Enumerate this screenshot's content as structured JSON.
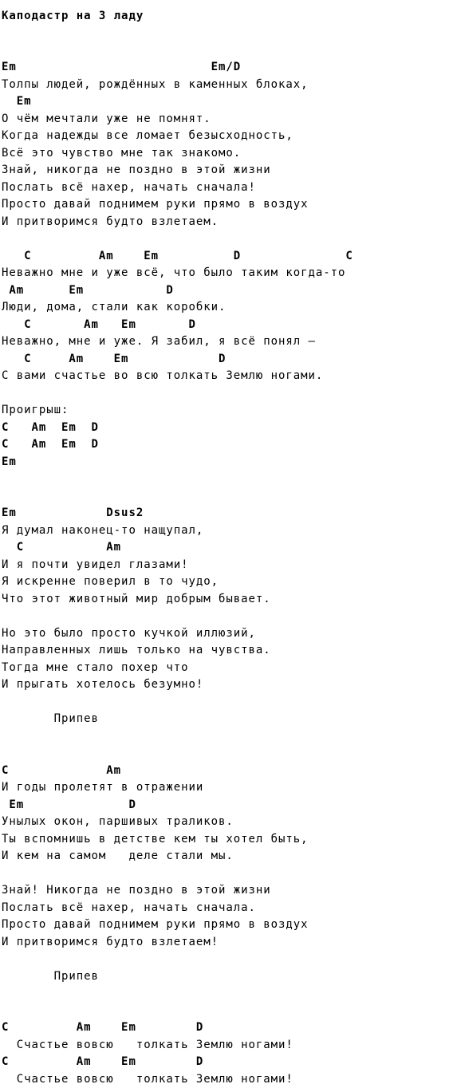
{
  "document": {
    "kind": "guitar-chord-sheet",
    "title": "Каподастр на 3 ладу",
    "language": "ru"
  },
  "lines": [
    {
      "type": "blank",
      "text": ""
    },
    {
      "type": "chord",
      "text": "Em                          Em/D"
    },
    {
      "type": "lyric",
      "text": "Толпы людей, рождённых в каменных блоках,"
    },
    {
      "type": "chord",
      "text": "  Em"
    },
    {
      "type": "lyric",
      "text": "О чём мечтали уже не помнят."
    },
    {
      "type": "lyric",
      "text": "Когда надежды все ломает безысходность,"
    },
    {
      "type": "lyric",
      "text": "Всё это чувство мне так знакомо."
    },
    {
      "type": "lyric",
      "text": "Знай, никогда не поздно в этой жизни"
    },
    {
      "type": "lyric",
      "text": "Послать всё нахер, начать сначала!"
    },
    {
      "type": "lyric",
      "text": "Просто давай поднимем руки прямо в воздух"
    },
    {
      "type": "lyric",
      "text": "И притворимся будто взлетаем."
    },
    {
      "type": "blank",
      "text": ""
    },
    {
      "type": "chord",
      "text": "   C         Am    Em          D              C"
    },
    {
      "type": "lyric",
      "text": "Неважно мне и уже всё, что было таким когда-то"
    },
    {
      "type": "chord",
      "text": " Am      Em           D"
    },
    {
      "type": "lyric",
      "text": "Люди, дома, стали как коробки."
    },
    {
      "type": "chord",
      "text": "   C       Am   Em       D"
    },
    {
      "type": "lyric",
      "text": "Неважно, мне и уже. Я забил, я всё понял –"
    },
    {
      "type": "chord",
      "text": "   C     Am    Em            D"
    },
    {
      "type": "lyric",
      "text": "С вами счастье во всю толкать Землю ногами."
    },
    {
      "type": "blank",
      "text": ""
    },
    {
      "type": "label",
      "text": "Проигрыш:"
    },
    {
      "type": "chord",
      "text": "C   Am  Em  D"
    },
    {
      "type": "chord",
      "text": "C   Am  Em  D"
    },
    {
      "type": "chord",
      "text": "Em"
    },
    {
      "type": "blank",
      "text": ""
    },
    {
      "type": "blank",
      "text": ""
    },
    {
      "type": "chord",
      "text": "Em            Dsus2"
    },
    {
      "type": "lyric",
      "text": "Я думал наконец-то нащупал,"
    },
    {
      "type": "chord",
      "text": "  C           Am"
    },
    {
      "type": "lyric",
      "text": "И я почти увидел глазами!"
    },
    {
      "type": "lyric",
      "text": "Я искренне поверил в то чудо,"
    },
    {
      "type": "lyric",
      "text": "Что этот животный мир добрым бывает."
    },
    {
      "type": "blank",
      "text": ""
    },
    {
      "type": "lyric",
      "text": "Но это было просто кучкой иллюзий,"
    },
    {
      "type": "lyric",
      "text": "Направленных лишь только на чувства."
    },
    {
      "type": "lyric",
      "text": "Тогда мне стало похер что"
    },
    {
      "type": "lyric",
      "text": "И прыгать хотелось безумно!"
    },
    {
      "type": "blank",
      "text": ""
    },
    {
      "type": "label",
      "text": "       Припев"
    },
    {
      "type": "blank",
      "text": ""
    },
    {
      "type": "blank",
      "text": ""
    },
    {
      "type": "chord",
      "text": "C             Am"
    },
    {
      "type": "lyric",
      "text": "И годы пролетят в отражении"
    },
    {
      "type": "chord",
      "text": " Em              D"
    },
    {
      "type": "lyric",
      "text": "Унылых окон, паршивых траликов."
    },
    {
      "type": "lyric",
      "text": "Ты вспомнишь в детстве кем ты хотел быть,"
    },
    {
      "type": "lyric",
      "text": "И кем на самом   деле стали мы."
    },
    {
      "type": "blank",
      "text": ""
    },
    {
      "type": "lyric",
      "text": "Знай! Никогда не поздно в этой жизни"
    },
    {
      "type": "lyric",
      "text": "Послать всё нахер, начать сначала."
    },
    {
      "type": "lyric",
      "text": "Просто давай поднимем руки прямо в воздух"
    },
    {
      "type": "lyric",
      "text": "И притворимся будто взлетаем!"
    },
    {
      "type": "blank",
      "text": ""
    },
    {
      "type": "label",
      "text": "       Припев"
    },
    {
      "type": "blank",
      "text": ""
    },
    {
      "type": "blank",
      "text": ""
    },
    {
      "type": "chord",
      "text": "C         Am    Em        D"
    },
    {
      "type": "lyric",
      "text": "  Счастье вовсю   толкать Землю ногами!"
    },
    {
      "type": "chord",
      "text": "C         Am    Em        D"
    },
    {
      "type": "lyric",
      "text": "  Счастье вовсю   толкать Землю ногами!"
    }
  ]
}
